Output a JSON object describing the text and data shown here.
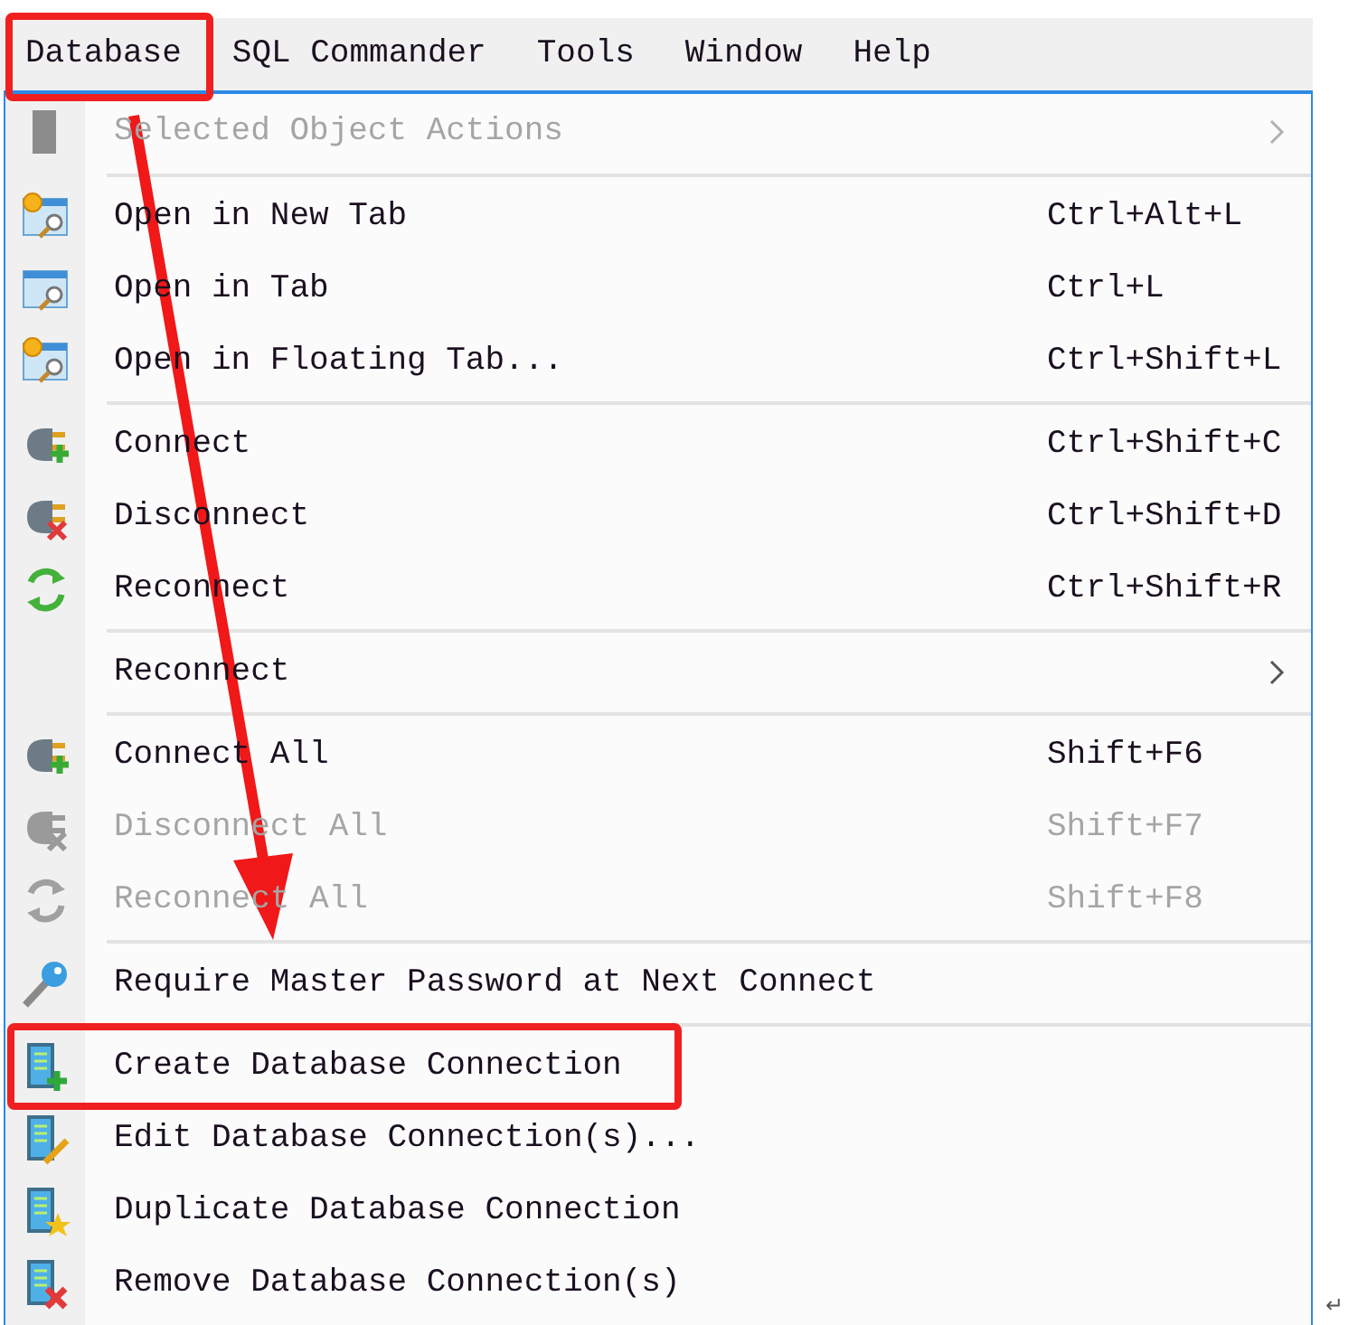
{
  "menubar": [
    {
      "label": "Database",
      "highlighted": true
    },
    {
      "label": "SQL Commander",
      "highlighted": false
    },
    {
      "label": "Tools",
      "highlighted": false
    },
    {
      "label": "Window",
      "highlighted": false
    },
    {
      "label": "Help",
      "highlighted": false
    }
  ],
  "menu": {
    "sections": [
      {
        "items": [
          {
            "label": "Selected Object Actions",
            "kind": "object",
            "disabled": true,
            "submenu": true,
            "highlighted": false
          }
        ]
      },
      {
        "items": [
          {
            "label": "Open in New Tab",
            "shortcut": "Ctrl+Alt+L",
            "kind": "tab-new",
            "disabled": false,
            "submenu": false,
            "highlighted": false
          },
          {
            "label": "Open in Tab",
            "shortcut": "Ctrl+L",
            "kind": "tab",
            "disabled": false,
            "submenu": false,
            "highlighted": false
          },
          {
            "label": "Open in Floating Tab...",
            "shortcut": "Ctrl+Shift+L",
            "kind": "tab-new",
            "disabled": false,
            "submenu": false,
            "highlighted": false
          }
        ]
      },
      {
        "items": [
          {
            "label": "Connect",
            "shortcut": "Ctrl+Shift+C",
            "kind": "plug-add",
            "disabled": false,
            "submenu": false,
            "highlighted": false
          },
          {
            "label": "Disconnect",
            "shortcut": "Ctrl+Shift+D",
            "kind": "plug-remove",
            "disabled": false,
            "submenu": false,
            "highlighted": false
          },
          {
            "label": "Reconnect",
            "shortcut": "Ctrl+Shift+R",
            "kind": "refresh",
            "disabled": false,
            "submenu": false,
            "highlighted": false
          }
        ]
      },
      {
        "items": [
          {
            "label": "Reconnect",
            "kind": "none",
            "disabled": false,
            "submenu": true,
            "highlighted": false
          }
        ]
      },
      {
        "items": [
          {
            "label": "Connect All",
            "shortcut": "Shift+F6",
            "kind": "plug-add",
            "disabled": false,
            "submenu": false,
            "highlighted": false
          },
          {
            "label": "Disconnect All",
            "shortcut": "Shift+F7",
            "kind": "plug-remove",
            "disabled": true,
            "submenu": false,
            "highlighted": false
          },
          {
            "label": "Reconnect All",
            "shortcut": "Shift+F8",
            "kind": "refresh",
            "disabled": true,
            "submenu": false,
            "highlighted": false
          }
        ]
      },
      {
        "items": [
          {
            "label": "Require Master Password at Next Connect",
            "kind": "key",
            "disabled": false,
            "submenu": false,
            "highlighted": false
          }
        ]
      },
      {
        "items": [
          {
            "label": "Create Database Connection",
            "kind": "db-add",
            "disabled": false,
            "submenu": false,
            "highlighted": true
          },
          {
            "label": "Edit Database Connection(s)...",
            "kind": "db-edit",
            "disabled": false,
            "submenu": false,
            "highlighted": false
          },
          {
            "label": "Duplicate Database Connection",
            "kind": "db-star",
            "disabled": false,
            "submenu": false,
            "highlighted": false
          },
          {
            "label": "Remove Database Connection(s)",
            "kind": "db-remove",
            "disabled": false,
            "submenu": false,
            "highlighted": false
          }
        ]
      }
    ]
  },
  "paragraph_mark": "↵"
}
